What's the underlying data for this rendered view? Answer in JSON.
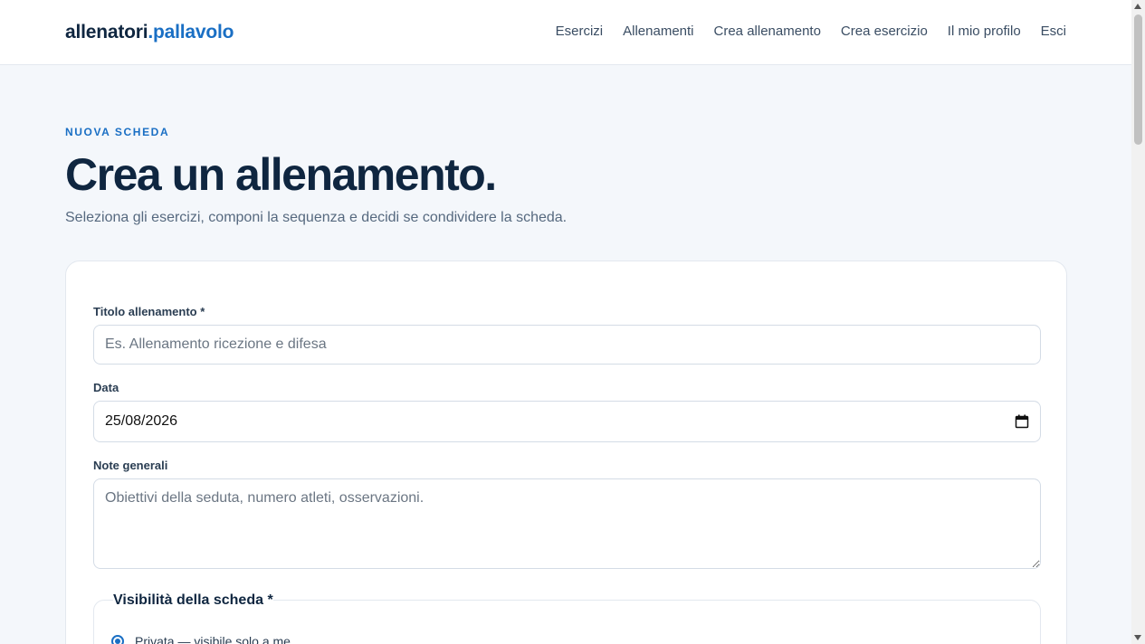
{
  "brand": {
    "name_main": "allenatori",
    "name_accent": ".pallavolo"
  },
  "nav": [
    {
      "label": "Esercizi"
    },
    {
      "label": "Allenamenti"
    },
    {
      "label": "Crea allenamento"
    },
    {
      "label": "Crea esercizio"
    },
    {
      "label": "Il mio profilo"
    },
    {
      "label": "Esci"
    }
  ],
  "header": {
    "eyebrow": "NUOVA SCHEDA",
    "title": "Crea un allenamento.",
    "subtitle": "Seleziona gli esercizi, componi la sequenza e decidi se condividere la scheda."
  },
  "form": {
    "title_label": "Titolo allenamento *",
    "title_placeholder": "Es. Allenamento ricezione e difesa",
    "date_label": "Data",
    "date_value": "25/08/2026",
    "notes_label": "Note generali",
    "notes_placeholder": "Obiettivi della seduta, numero atleti, osservazioni.",
    "visibility_legend": "Visibilità della scheda *",
    "visibility_option_private": "Privata — visibile solo a me"
  },
  "colors": {
    "accent": "#1a6fc4",
    "text_dark": "#0f2640",
    "background": "#f4f7fb"
  },
  "icons": {
    "date_picker": "calendar-icon"
  }
}
